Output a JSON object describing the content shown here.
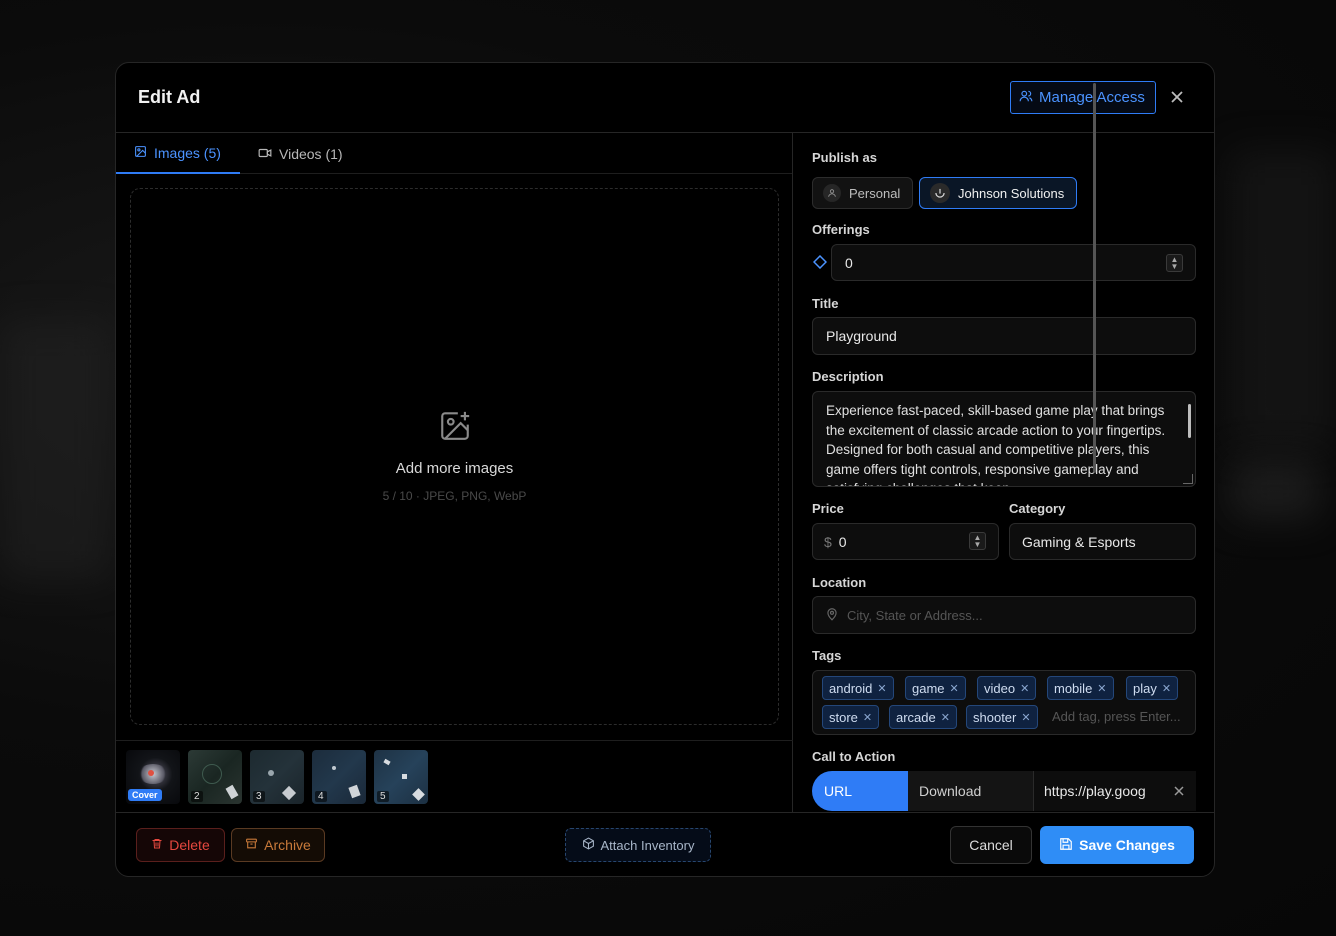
{
  "modal": {
    "title": "Edit Ad",
    "manage_access_label": "Manage Access"
  },
  "media_tabs": [
    {
      "label": "Images (5)",
      "icon": "image-icon",
      "active": true
    },
    {
      "label": "Videos (1)",
      "icon": "video-icon",
      "active": false
    }
  ],
  "dropzone": {
    "title": "Add more images",
    "subtitle": "5 / 10 · JPEG, PNG, WebP"
  },
  "thumbnails": [
    {
      "badge": "Cover"
    },
    {
      "badge": "2"
    },
    {
      "badge": "3"
    },
    {
      "badge": "4"
    },
    {
      "badge": "5"
    }
  ],
  "form": {
    "publish_as": {
      "label": "Publish as",
      "options": [
        {
          "label": "Personal",
          "selected": false
        },
        {
          "label": "Johnson Solutions",
          "selected": true
        }
      ]
    },
    "offerings": {
      "label": "Offerings",
      "value": "0"
    },
    "title": {
      "label": "Title",
      "value": "Playground"
    },
    "description": {
      "label": "Description",
      "value": "Experience fast-paced, skill-based game play that brings the excitement of classic arcade action to your fingertips. Designed for both casual and competitive players, this game offers tight controls, responsive gameplay and satisfying challenges that keep..."
    },
    "price": {
      "label": "Price",
      "currency": "$",
      "value": "0"
    },
    "category": {
      "label": "Category",
      "value": "Gaming & Esports"
    },
    "location": {
      "label": "Location",
      "placeholder": "City, State or Address..."
    },
    "tags": {
      "label": "Tags",
      "items": [
        "android",
        "game",
        "video",
        "mobile",
        "play",
        "store",
        "arcade",
        "shooter"
      ],
      "placeholder": "Add tag, press Enter..."
    },
    "cta": {
      "label": "Call to Action",
      "types": [
        {
          "label": "URL",
          "selected": true
        },
        {
          "label": "Download",
          "selected": false
        }
      ],
      "value": "https://play.goog"
    }
  },
  "footer": {
    "delete_label": "Delete",
    "archive_label": "Archive",
    "attach_label": "Attach Inventory",
    "cancel_label": "Cancel",
    "save_label": "Save Changes"
  },
  "colors": {
    "accent": "#2f7cf6",
    "danger": "#e5483f",
    "warning": "#c97a3a",
    "tag_bg": "#0f2240"
  }
}
